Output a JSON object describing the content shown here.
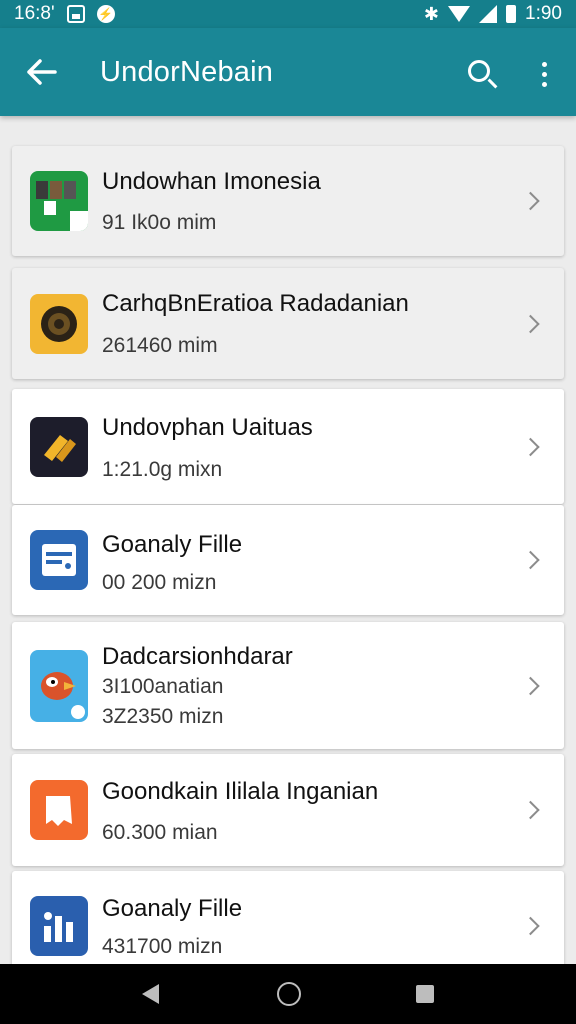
{
  "status_bar": {
    "time_left": "16:8'",
    "time_right": "1:90",
    "notification_icons": [
      "screenshot-icon",
      "messenger-icon"
    ],
    "system_icons": [
      "bluetooth-icon",
      "wifi-icon",
      "signal-icon",
      "battery-icon"
    ]
  },
  "app_bar": {
    "title": "UndorNebain",
    "back_icon": "arrow-back-icon",
    "search_icon": "search-icon",
    "more_icon": "more-vertical-icon"
  },
  "items": [
    {
      "title": "Undowhan Imonesia",
      "subtitle": "91 Ik0o mim",
      "icon": "photo-grid-app-icon",
      "color": "#1f9a43"
    },
    {
      "title": "CarhqBnEratioa Radadanian",
      "subtitle": "261460 mim",
      "icon": "sun-dial-app-icon",
      "color": "#f2b632"
    },
    {
      "title": "Undovphan Uaituas",
      "subtitle": "1:21.0g mixn",
      "icon": "gold-tickets-app-icon",
      "color": "#1d1d2b"
    },
    {
      "title": "Goanaly Fille",
      "subtitle": "00 200 mizn",
      "icon": "blue-file-app-icon",
      "color": "#2b68b5"
    },
    {
      "title": "Dadcarsionhdarar",
      "subtitle": "3I100anatian",
      "subtitle2": "3Z2350 mizn",
      "icon": "bird-game-app-icon",
      "color": "#46b0e6"
    },
    {
      "title": "Goondkain Ililala Inganian",
      "subtitle": "60.300 mian",
      "icon": "orange-tag-app-icon",
      "color": "#f36a2d"
    },
    {
      "title": "Goanaly Fille",
      "subtitle": "431700 mizn",
      "icon": "blue-chart-app-icon",
      "color": "#2a5fae"
    }
  ],
  "nav_bar": {
    "back_icon": "nav-back-icon",
    "home_icon": "nav-home-icon",
    "recents_icon": "nav-recents-icon"
  }
}
